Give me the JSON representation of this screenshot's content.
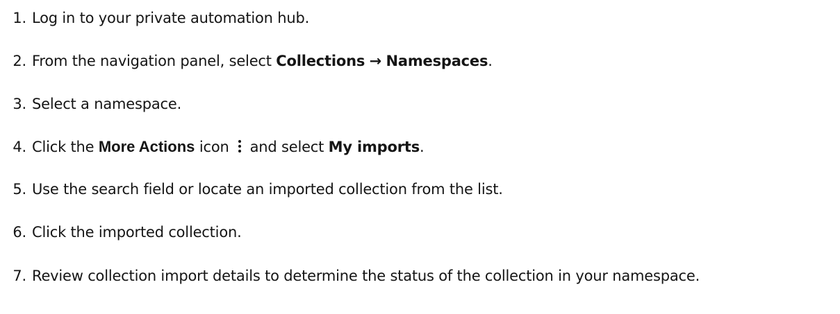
{
  "steps": [
    {
      "number": "1.",
      "text": "Log in to your private automation hub."
    },
    {
      "number": "2.",
      "prefix": "From the navigation panel, select ",
      "menu_1": "Collections",
      "arrow": "→",
      "menu_2": "Namespaces",
      "suffix": "."
    },
    {
      "number": "3.",
      "text": "Select a namespace."
    },
    {
      "number": "4.",
      "prefix": "Click the ",
      "button": "More Actions",
      "middle": " icon",
      "icon": "kebab-vertical-icon",
      "after_icon": "and select ",
      "menu": "My imports",
      "suffix": "."
    },
    {
      "number": "5.",
      "text": "Use the search field or locate an imported collection from the list."
    },
    {
      "number": "6.",
      "text": "Click the imported collection."
    },
    {
      "number": "7.",
      "text": "Review collection import details to determine the status of the collection in your namespace."
    }
  ]
}
